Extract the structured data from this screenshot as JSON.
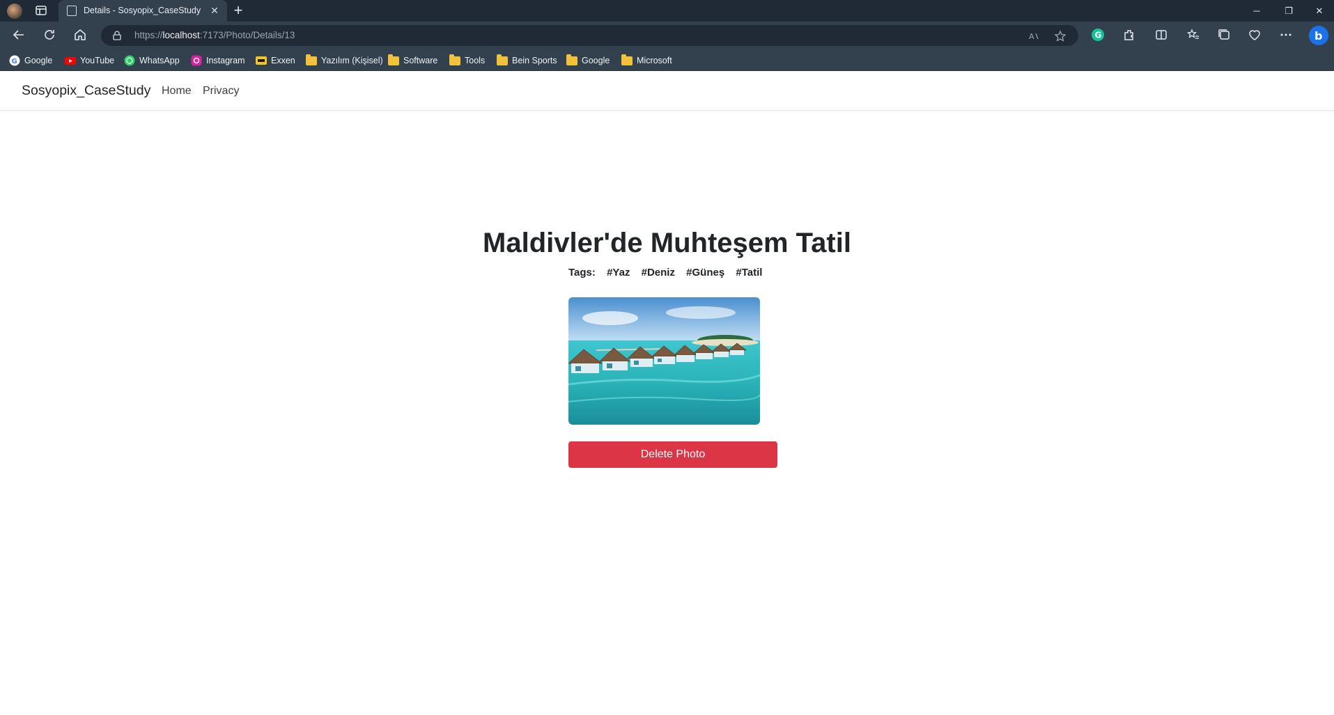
{
  "browser": {
    "tab_title": "Details - Sosyopix_CaseStudy",
    "url_prefix": "https://",
    "url_host": "localhost",
    "url_path": ":7173/Photo/Details/13",
    "bookmarks": [
      {
        "label": "Google",
        "icon": "google-icon"
      },
      {
        "label": "YouTube",
        "icon": "youtube-icon"
      },
      {
        "label": "WhatsApp",
        "icon": "whatsapp-icon"
      },
      {
        "label": "Instagram",
        "icon": "instagram-icon"
      },
      {
        "label": "Exxen",
        "icon": "exxen-icon"
      },
      {
        "label": "Yazılım (Kişisel)",
        "icon": "folder-icon"
      },
      {
        "label": "Software",
        "icon": "folder-icon"
      },
      {
        "label": "Tools",
        "icon": "folder-icon"
      },
      {
        "label": "Bein Sports",
        "icon": "folder-icon"
      },
      {
        "label": "Google",
        "icon": "folder-icon"
      },
      {
        "label": "Microsoft",
        "icon": "folder-icon"
      }
    ]
  },
  "site": {
    "brand": "Sosyopix_CaseStudy",
    "nav": [
      "Home",
      "Privacy"
    ]
  },
  "photo": {
    "title": "Maldivler'de Muhteşem Tatil",
    "tags_label": "Tags:",
    "tags": [
      "#Yaz",
      "#Deniz",
      "#Güneş",
      "#Tatil"
    ],
    "image_subject": "maldives-overwater-bungalows",
    "delete_label": "Delete Photo"
  },
  "colors": {
    "danger": "#dc3545",
    "chrome_dark": "#202a36",
    "chrome": "#33414f"
  }
}
